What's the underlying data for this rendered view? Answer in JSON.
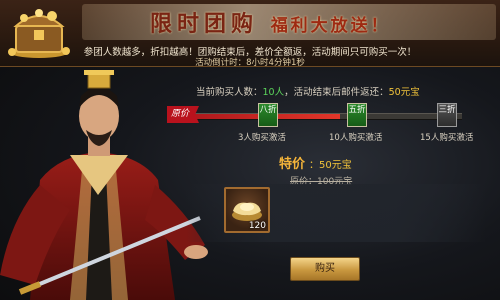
{
  "banner": {
    "title_main": "限时团购",
    "title_sub": "福利大放送！",
    "notice": "参团人数越多，折扣越高！团购结束后，差价全额返，活动期间只可购买一次！",
    "countdown_label": "活动倒计时：",
    "countdown_value": "8小时4分钟1秒"
  },
  "progress": {
    "buyers_label": "当前购买人数：",
    "buyers_count": "10人",
    "refund_label": "，活动结束后邮件返还：",
    "refund_value": "50元宝",
    "origin_tag": "原价",
    "fill_fraction": 0.58,
    "stages": [
      {
        "badge": "八折",
        "label": "3人购买激活",
        "state": "active"
      },
      {
        "badge": "五折",
        "label": "10人购买激活",
        "state": "active"
      },
      {
        "badge": "三折",
        "label": "15人购买激活",
        "state": "locked"
      }
    ]
  },
  "offer": {
    "special_label": "特价",
    "special_price": "：50元宝",
    "original_price": "原价：100元宝",
    "item_name": "ingot-item",
    "item_qty": "120"
  },
  "actions": {
    "buy_label": "购买"
  },
  "colors": {
    "accent_gold": "#f0c23a",
    "accent_green": "#5bd35b",
    "accent_red": "#e23629"
  }
}
